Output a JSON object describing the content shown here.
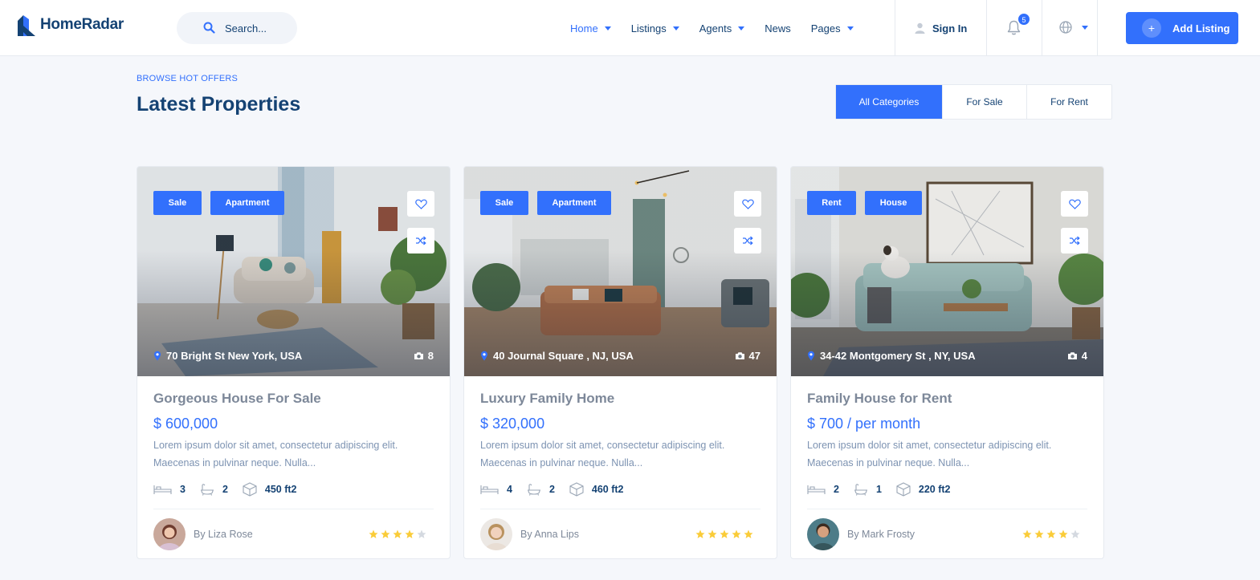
{
  "brand": {
    "name": "HomeRadar",
    "color": "#144273",
    "accent": "#3270fc"
  },
  "search": {
    "placeholder": "Search..."
  },
  "nav": [
    {
      "label": "Home",
      "active": true,
      "dropdown": true
    },
    {
      "label": "Listings",
      "dropdown": true
    },
    {
      "label": "Agents",
      "dropdown": true
    },
    {
      "label": "News",
      "dropdown": false
    },
    {
      "label": "Pages",
      "dropdown": true
    }
  ],
  "header": {
    "sign_in": "Sign In",
    "notifications_count": "5",
    "add_listing": "Add Listing",
    "icons": [
      "search-icon",
      "user-icon",
      "bell-icon",
      "globe-icon",
      "plus-icon"
    ]
  },
  "section": {
    "eyebrow": "BROWSE HOT OFFERS",
    "title": "Latest Properties",
    "filters": [
      {
        "label": "All Categories",
        "active": true
      },
      {
        "label": "For Sale"
      },
      {
        "label": "For Rent"
      }
    ]
  },
  "cards": [
    {
      "tags": [
        "Sale",
        "Apartment"
      ],
      "address": "70 Bright St New York, USA",
      "photos": "8",
      "title": "Gorgeous House For Sale",
      "price": "$ 600,000",
      "desc_line1": "Lorem ipsum dolor sit amet, consectetur adipiscing elit.",
      "desc_line2": "Maecenas in pulvinar neque. Nulla...",
      "beds": "3",
      "baths": "2",
      "area": "450 ft2",
      "author": "By Liza Rose",
      "rating": 4
    },
    {
      "tags": [
        "Sale",
        "Apartment"
      ],
      "address": "40 Journal Square , NJ, USA",
      "photos": "47",
      "title": "Luxury Family Home",
      "price": "$ 320,000",
      "desc_line1": "Lorem ipsum dolor sit amet, consectetur adipiscing elit.",
      "desc_line2": "Maecenas in pulvinar neque. Nulla...",
      "beds": "4",
      "baths": "2",
      "area": "460 ft2",
      "author": "By Anna Lips",
      "rating": 5
    },
    {
      "tags": [
        "Rent",
        "House"
      ],
      "address": "34-42 Montgomery St , NY, USA",
      "photos": "4",
      "title": "Family House for Rent",
      "price": "$ 700 / per month",
      "desc_line1": "Lorem ipsum dolor sit amet, consectetur adipiscing elit.",
      "desc_line2": "Maecenas in pulvinar neque. Nulla...",
      "beds": "2",
      "baths": "1",
      "area": "220 ft2",
      "author": "By Mark Frosty",
      "rating": 4
    }
  ]
}
